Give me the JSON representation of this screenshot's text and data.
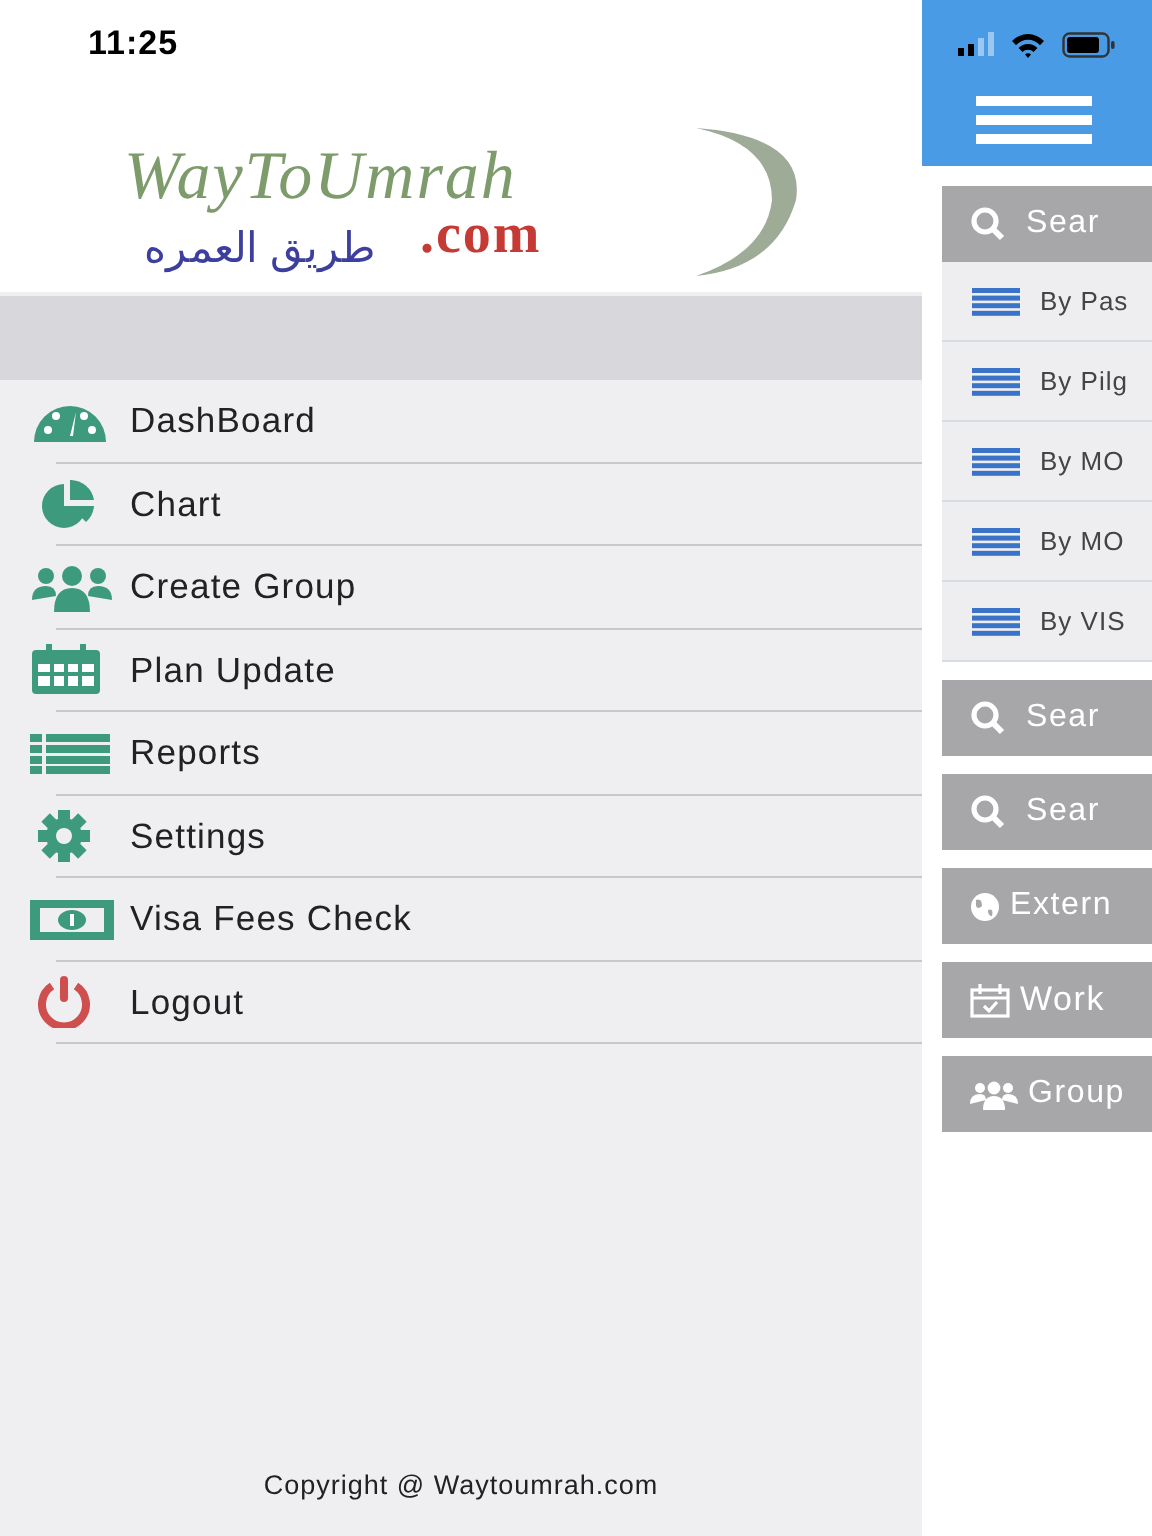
{
  "status_bar": {
    "time": "11:25"
  },
  "logo": {
    "name": "WayToUmrah",
    "arabic": "طريق العمره",
    "domain": ".com"
  },
  "menu": [
    {
      "label": "DashBoard"
    },
    {
      "label": "Chart"
    },
    {
      "label": "Create Group"
    },
    {
      "label": "Plan Update"
    },
    {
      "label": "Reports"
    },
    {
      "label": "Settings"
    },
    {
      "label": "Visa Fees Check"
    },
    {
      "label": "Logout"
    }
  ],
  "footer": "Copyright @ Waytoumrah.com",
  "panel": {
    "buttons": [
      {
        "label": "Sear",
        "kind": "search",
        "children": [
          {
            "label": "By Pas"
          },
          {
            "label": "By Pilg"
          },
          {
            "label": "By MO"
          },
          {
            "label": "By MO"
          },
          {
            "label": "By VIS"
          }
        ]
      },
      {
        "label": "Sear",
        "kind": "search"
      },
      {
        "label": "Sear",
        "kind": "search"
      },
      {
        "label": "Extern",
        "kind": "globe"
      },
      {
        "label": "Work",
        "kind": "calendar"
      },
      {
        "label": "Group",
        "kind": "people"
      }
    ]
  }
}
